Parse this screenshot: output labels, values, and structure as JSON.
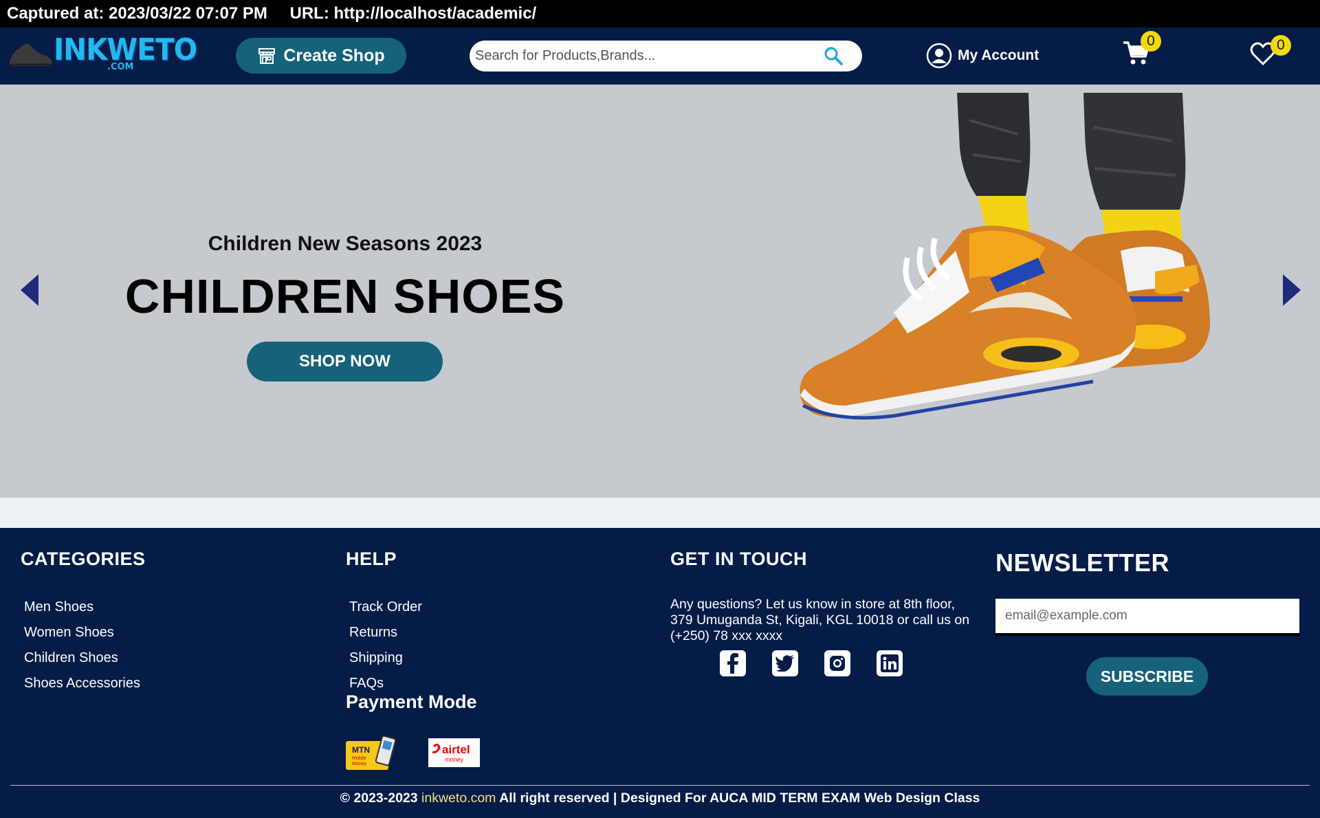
{
  "capture": {
    "captured_at": "Captured at: 2023/03/22 07:07 PM",
    "url": "URL: http://localhost/academic/"
  },
  "header": {
    "logo_text": "INKWETO",
    "logo_suffix": ".COM",
    "create_shop_label": "Create Shop",
    "search_placeholder": "Search for Products,Brands...",
    "account_label": "My Account",
    "cart_count": "0",
    "wishlist_count": "0"
  },
  "hero": {
    "subtitle": "Children New Seasons 2023",
    "title": "CHILDREN SHOES",
    "cta_label": "SHOP NOW"
  },
  "footer": {
    "categories": {
      "heading": "CATEGORIES",
      "items": [
        "Men Shoes",
        "Women Shoes",
        "Children Shoes",
        "Shoes Accessories"
      ]
    },
    "help": {
      "heading": "HELP",
      "items": [
        "Track Order",
        "Returns",
        "Shipping",
        "FAQs"
      ]
    },
    "payment": {
      "heading": "Payment Mode",
      "mtn_text": "MTN",
      "mtn_sub1": "Mobile",
      "mtn_sub2": "Money",
      "airtel_text": "airtel",
      "airtel_sub": "money"
    },
    "contact": {
      "heading": "GET IN TOUCH",
      "text": "Any questions? Let us know in store at 8th floor, 379 Umuganda St, Kigali, KGL 10018 or call us on (+250) 78 xxx xxxx",
      "socials": [
        "facebook-icon",
        "twitter-icon",
        "instagram-icon",
        "linkedin-icon"
      ]
    },
    "newsletter": {
      "heading": "NEWSLETTER",
      "email_placeholder": "email@example.com",
      "subscribe_label": "SUBSCRIBE"
    },
    "copyright_pre": "© 2023-2023",
    "copyright_site": "inkweto.com",
    "copyright_post": "All right reserved | Designed For AUCA MID TERM EXAM Web Design Class"
  },
  "colors": {
    "navy": "#051c47",
    "teal_button": "#16627a",
    "badge_yellow": "#f5d90a",
    "logo_blue": "#23b8ee",
    "hero_bg": "#c6c9ce"
  }
}
